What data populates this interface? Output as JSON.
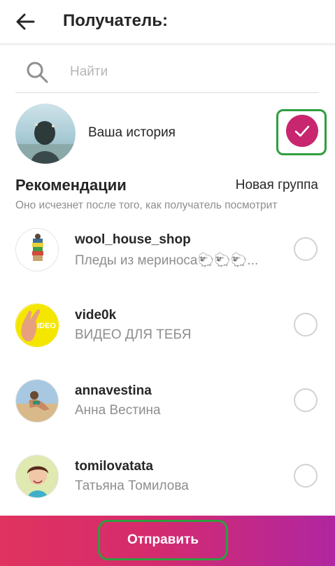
{
  "header": {
    "title": "Получатель:"
  },
  "search": {
    "placeholder": "Найти",
    "value": ""
  },
  "story": {
    "label": "Ваша история",
    "selected": true
  },
  "recommendations": {
    "title": "Рекомендации",
    "new_group_label": "Новая группа",
    "subtitle": "Оно исчезнет после того, как получатель посмотрит"
  },
  "contacts": [
    {
      "username": "wool_house_shop",
      "subtitle": "Пледы из мериноса🐑🐑🐑...",
      "selected": false
    },
    {
      "username": "vide0k",
      "subtitle": "ВИДЕО ДЛЯ ТЕБЯ",
      "selected": false
    },
    {
      "username": "annavestina",
      "subtitle": "Анна Вестина",
      "selected": false
    },
    {
      "username": "tomilovatata",
      "subtitle": "Татьяна Томилова",
      "selected": false
    }
  ],
  "send_button": {
    "label": "Отправить"
  },
  "avatar_badge_text": "IDEO",
  "colors": {
    "accent": "#c8266e",
    "gradient_start": "#e0335f",
    "gradient_end": "#b026a0",
    "highlight": "#2e9e3e"
  }
}
